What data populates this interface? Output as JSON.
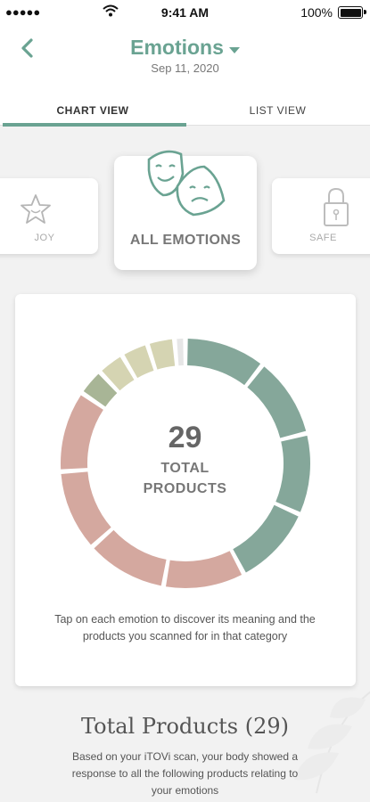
{
  "status_bar": {
    "signal": "●●●●●",
    "time": "9:41 AM",
    "battery": "100%"
  },
  "header": {
    "title": "Emotions",
    "date": "Sep 11, 2020"
  },
  "tabs": [
    {
      "label": "CHART VIEW",
      "active": true
    },
    {
      "label": "LIST VIEW",
      "active": false
    }
  ],
  "categories": [
    {
      "label": "JOY",
      "icon": "star-icon"
    },
    {
      "label": "ALL EMOTIONS",
      "icon": "theater-masks-icon",
      "selected": true
    },
    {
      "label": "SAFE",
      "icon": "padlock-icon"
    }
  ],
  "chart": {
    "total": "29",
    "total_line1": "TOTAL",
    "total_line2": "PRODUCTS",
    "hint": "Tap on each emotion to discover its meaning and the products you scanned for in that category"
  },
  "chart_data": {
    "type": "donut",
    "center_label": "29 TOTAL PRODUCTS",
    "segments": [
      {
        "value": 3,
        "color": "#85a79a"
      },
      {
        "value": 3,
        "color": "#85a79a"
      },
      {
        "value": 3,
        "color": "#85a79a"
      },
      {
        "value": 3,
        "color": "#85a79a"
      },
      {
        "value": 3,
        "color": "#d4a89f"
      },
      {
        "value": 3,
        "color": "#d4a89f"
      },
      {
        "value": 3,
        "color": "#d4a89f"
      },
      {
        "value": 3,
        "color": "#d4a89f"
      },
      {
        "value": 1,
        "color": "#a8b596"
      },
      {
        "value": 1,
        "color": "#d5d4b2"
      },
      {
        "value": 1,
        "color": "#d5d4b2"
      },
      {
        "value": 1,
        "color": "#d5d4b2"
      },
      {
        "value": 0.4,
        "color": "#e6e6e6"
      }
    ]
  },
  "section": {
    "title": "Total Products (29)",
    "description": "Based on your iTOVi scan, your body showed a response to all the following products relating to your emotions"
  },
  "colors": {
    "accent": "#6aa392",
    "background": "#f2f2f2"
  }
}
